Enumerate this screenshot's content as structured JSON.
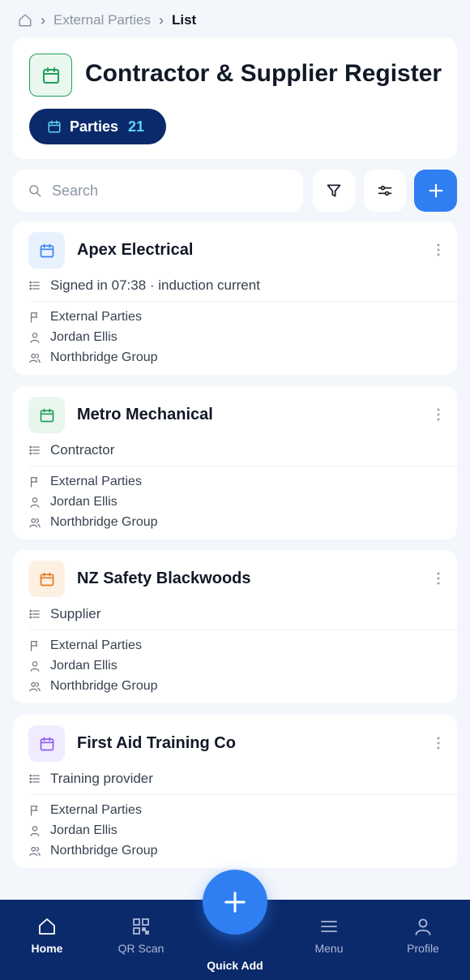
{
  "breadcrumb": {
    "items": [
      "External Parties"
    ],
    "current": "List"
  },
  "header": {
    "title": "Contractor & Supplier Register",
    "pill_label": "Parties",
    "pill_count": "21"
  },
  "search": {
    "placeholder": "Search",
    "value": ""
  },
  "parties": [
    {
      "name": "Apex Electrical",
      "description": "Signed in 07:38 · induction current",
      "module": "External Parties",
      "owner": "Jordan Ellis",
      "group": "Northbridge Group",
      "icon_color": "#3b82f6",
      "icon_bg": "#e8f1fe"
    },
    {
      "name": "Metro Mechanical",
      "description": "Contractor",
      "module": "External Parties",
      "owner": "Jordan Ellis",
      "group": "Northbridge Group",
      "icon_color": "#22a05a",
      "icon_bg": "#e8f6ee"
    },
    {
      "name": "NZ Safety Blackwoods",
      "description": "Supplier",
      "module": "External Parties",
      "owner": "Jordan Ellis",
      "group": "Northbridge Group",
      "icon_color": "#ea7a1a",
      "icon_bg": "#fdf0e3"
    },
    {
      "name": "First Aid Training Co",
      "description": "Training provider",
      "module": "External Parties",
      "owner": "Jordan Ellis",
      "group": "Northbridge Group",
      "icon_color": "#8b5cf6",
      "icon_bg": "#f1ebfe"
    }
  ],
  "nav": {
    "home": "Home",
    "qr_scan": "QR Scan",
    "quick_add": "Quick Add",
    "menu": "Menu",
    "profile": "Profile"
  },
  "colors": {
    "accent": "#2f7ff2",
    "navy": "#0b2a6b",
    "count": "#5fd3f3",
    "title_icon": "#22a05a"
  },
  "icons": {
    "breadcrumb": [
      "home-icon",
      "chevron-right-icon"
    ],
    "toolbar": [
      "search-icon",
      "filter-icon",
      "sliders-icon",
      "plus-icon"
    ],
    "card": [
      "calendar-icon",
      "more-vertical-icon",
      "list-icon",
      "flag-icon",
      "user-icon",
      "users-icon"
    ],
    "nav": [
      "home-icon",
      "qr-code-icon",
      "plus-icon",
      "menu-icon",
      "profile-icon"
    ]
  }
}
